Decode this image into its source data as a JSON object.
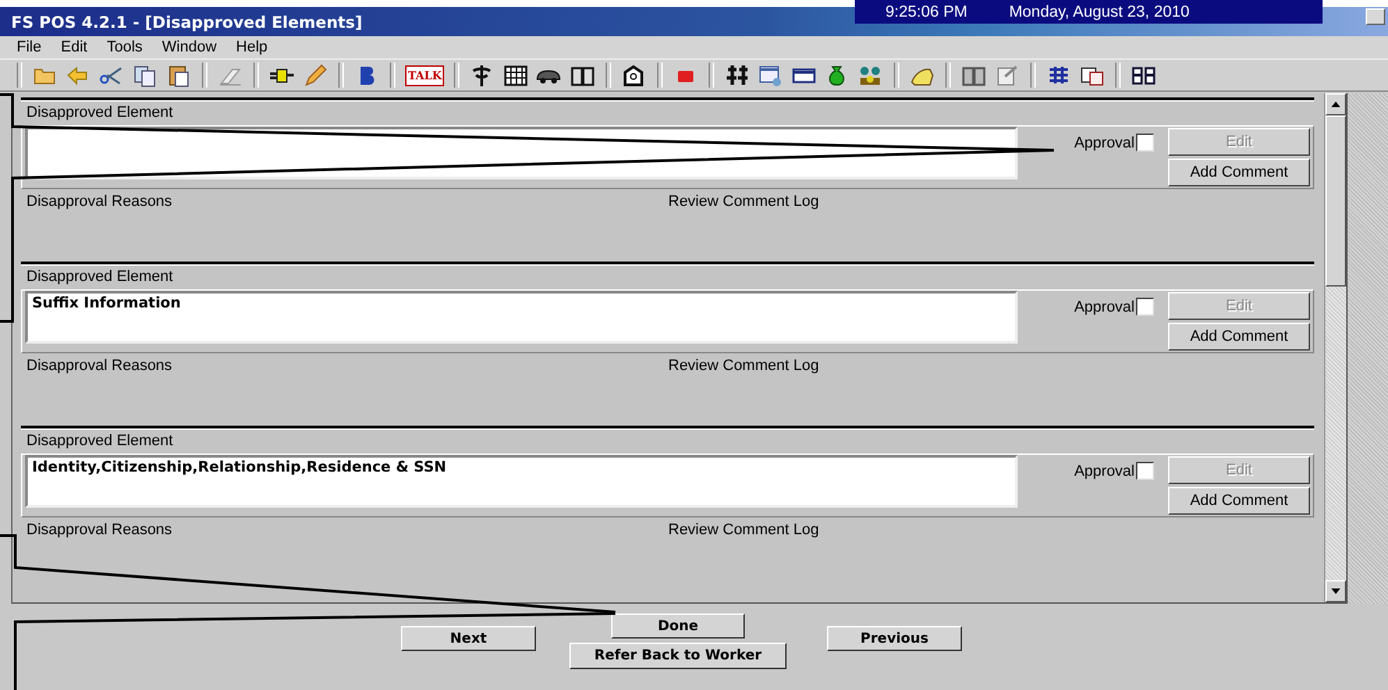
{
  "window": {
    "title": "FS POS 4.2.1 - [Disapproved Elements]",
    "time": "9:25:06 PM",
    "date": "Monday, August 23, 2010"
  },
  "menu": [
    "File",
    "Edit",
    "Tools",
    "Window",
    "Help"
  ],
  "toolbar": {
    "talk_label": "TALK"
  },
  "sections": [
    {
      "label": "Disapproved Element",
      "approval_label": "Approval",
      "approved": false,
      "edit": {
        "label": "Edit",
        "disabled": true
      },
      "add_comment": "Add Comment",
      "reasons_label": "Disapproval Reasons",
      "log_label": "Review Comment Log"
    },
    {
      "label": "Disapproved Element",
      "value": "Suffix Information",
      "approval_label": "Approval",
      "approved": false,
      "edit": {
        "label": "Edit",
        "disabled": true
      },
      "add_comment": "Add Comment",
      "reasons_label": "Disapproval Reasons",
      "log_label": "Review Comment Log"
    },
    {
      "label": "Disapproved Element",
      "value": "Identity,Citizenship,Relationship,Residence & SSN",
      "approval_label": "Approval",
      "approved": false,
      "edit": {
        "label": "Edit",
        "disabled": true
      },
      "add_comment": "Add Comment",
      "reasons_label": "Disapproval Reasons",
      "log_label": "Review Comment Log"
    }
  ],
  "buttons": {
    "done": "Done",
    "next": "Next",
    "refer": "Refer Back to Worker",
    "previous": "Previous"
  }
}
